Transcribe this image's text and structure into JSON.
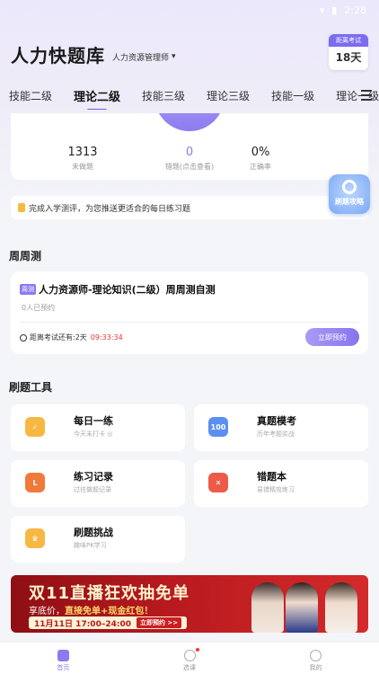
{
  "status_bar": {
    "time": "2:28"
  },
  "header": {
    "app_title": "人力快题库",
    "subject": "人力资源管理师",
    "countdown_caption": "距离考试",
    "countdown_days": "18天"
  },
  "tabs": [
    "技能二级",
    "理论二级",
    "技能三级",
    "理论三级",
    "技能一级",
    "理论一级"
  ],
  "active_tab_index": 1,
  "stats": [
    {
      "value": "1313",
      "label": "未做题"
    },
    {
      "value": "0",
      "label": "错题(点击查看)"
    },
    {
      "value": "0%",
      "label": "正确率"
    }
  ],
  "tip": {
    "text": "完成入学测评，为您推送更适合的每日练习题"
  },
  "strategy_badge": "刷题攻略",
  "weekly": {
    "section_title": "周周测",
    "badge": "周测",
    "title": "人力资源师-理论知识(二级）周周测自测",
    "subtitle": "0人已预约",
    "countdown_label": "距离考试还有:2天",
    "countdown_time": "09:33:34",
    "reserve_label": "立即预约"
  },
  "tools": {
    "section_title": "刷题工具",
    "items": [
      {
        "title": "每日一练",
        "subtitle": "今天未打卡 ◎",
        "icon": "check-icon",
        "color": "#f7b843"
      },
      {
        "title": "真题模考",
        "subtitle": "历年考题实战",
        "icon": "paper-100-icon",
        "color": "#5b8ff0"
      },
      {
        "title": "练习记录",
        "subtitle": "过往做题记录",
        "icon": "record-icon",
        "color": "#f07a3a"
      },
      {
        "title": "错题本",
        "subtitle": "易错精攻练习",
        "icon": "wrong-book-icon",
        "color": "#ee5a4a"
      },
      {
        "title": "刷题挑战",
        "subtitle": "趣味PK学习",
        "icon": "crown-icon",
        "color": "#f7b843"
      }
    ]
  },
  "banner": {
    "title": "双11直播狂欢抽免单",
    "subtitle_prefix": "享底价，",
    "subtitle_highlight": "直接免单+现金红包！",
    "time": "11月11日 17:00–24:00",
    "cta": "立即预约 >>"
  },
  "bottom_nav": [
    {
      "label": "首页",
      "icon": "home-icon"
    },
    {
      "label": "选课",
      "icon": "compass-icon"
    },
    {
      "label": "我的",
      "icon": "profile-icon"
    }
  ]
}
